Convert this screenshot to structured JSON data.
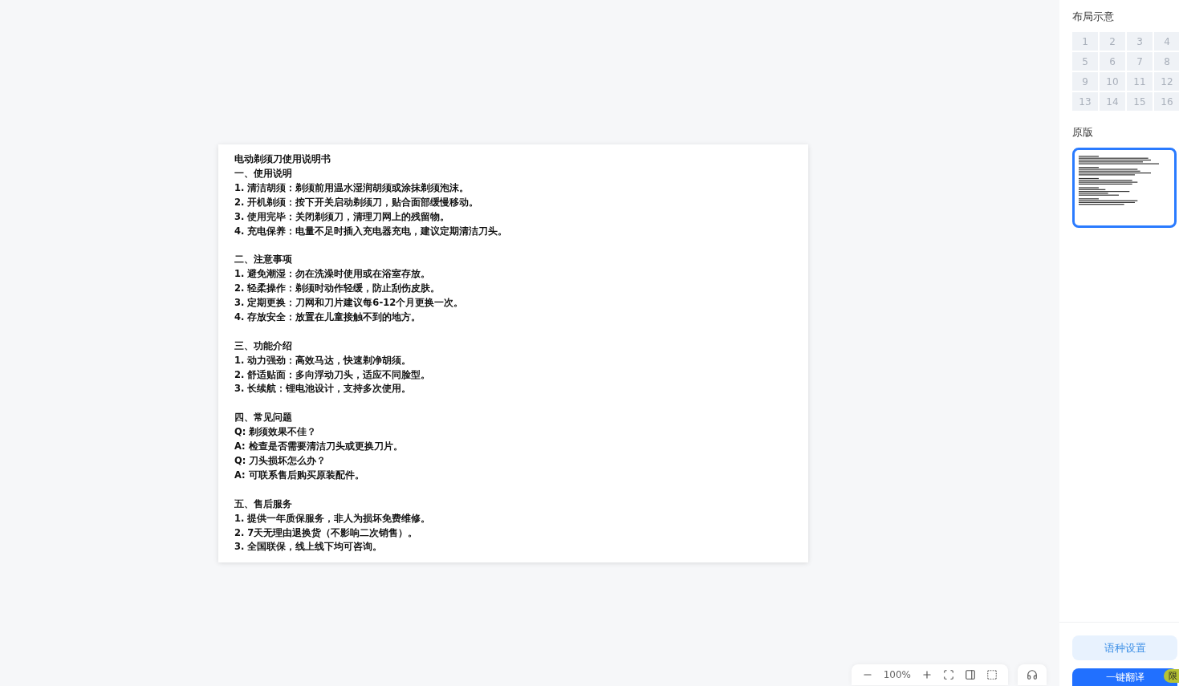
{
  "document": {
    "title": "电动剃须刀使用说明书",
    "sections": [
      {
        "heading": "一、使用说明",
        "lines": [
          "1. 清洁胡须：剃须前用温水湿润胡须或涂抹剃须泡沫。",
          "2. 开机剃须：按下开关启动剃须刀，贴合面部缓慢移动。",
          "3. 使用完毕：关闭剃须刀，清理刀网上的残留物。",
          "4. 充电保养：电量不足时插入充电器充电，建议定期清洁刀头。"
        ]
      },
      {
        "heading": "二、注意事项",
        "lines": [
          "1. 避免潮湿：勿在洗澡时使用或在浴室存放。",
          "2. 轻柔操作：剃须时动作轻缓，防止刮伤皮肤。",
          "3. 定期更换：刀网和刀片建议每6-12个月更换一次。",
          "4. 存放安全：放置在儿童接触不到的地方。"
        ]
      },
      {
        "heading": "三、功能介绍",
        "lines": [
          "1. 动力强劲：高效马达，快速剃净胡须。",
          "2. 舒适贴面：多向浮动刀头，适应不同脸型。",
          "3. 长续航：锂电池设计，支持多次使用。"
        ]
      },
      {
        "heading": "四、常见问题",
        "lines": [
          "Q: 剃须效果不佳？",
          "A: 检查是否需要清洁刀头或更换刀片。",
          "Q: 刀头损坏怎么办？",
          "A: 可联系售后购买原装配件。"
        ]
      },
      {
        "heading": "五、售后服务",
        "lines": [
          "1. 提供一年质保服务，非人为损坏免费维修。",
          "2. 7天无理由退换货（不影响二次销售）。",
          "3. 全国联保，线上线下均可咨询。"
        ]
      }
    ]
  },
  "zoom_toolbar": {
    "zoom": "100%"
  },
  "sidebar": {
    "layout_title": "布局示意",
    "layout_cells": [
      "1",
      "2",
      "3",
      "4",
      "5",
      "6",
      "7",
      "8",
      "9",
      "10",
      "11",
      "12",
      "13",
      "14",
      "15",
      "16"
    ],
    "original_title": "原版",
    "thumbnail": {
      "selected": true
    },
    "language_button": "语种设置",
    "translate_button": "一键翻译",
    "badge": "限"
  }
}
